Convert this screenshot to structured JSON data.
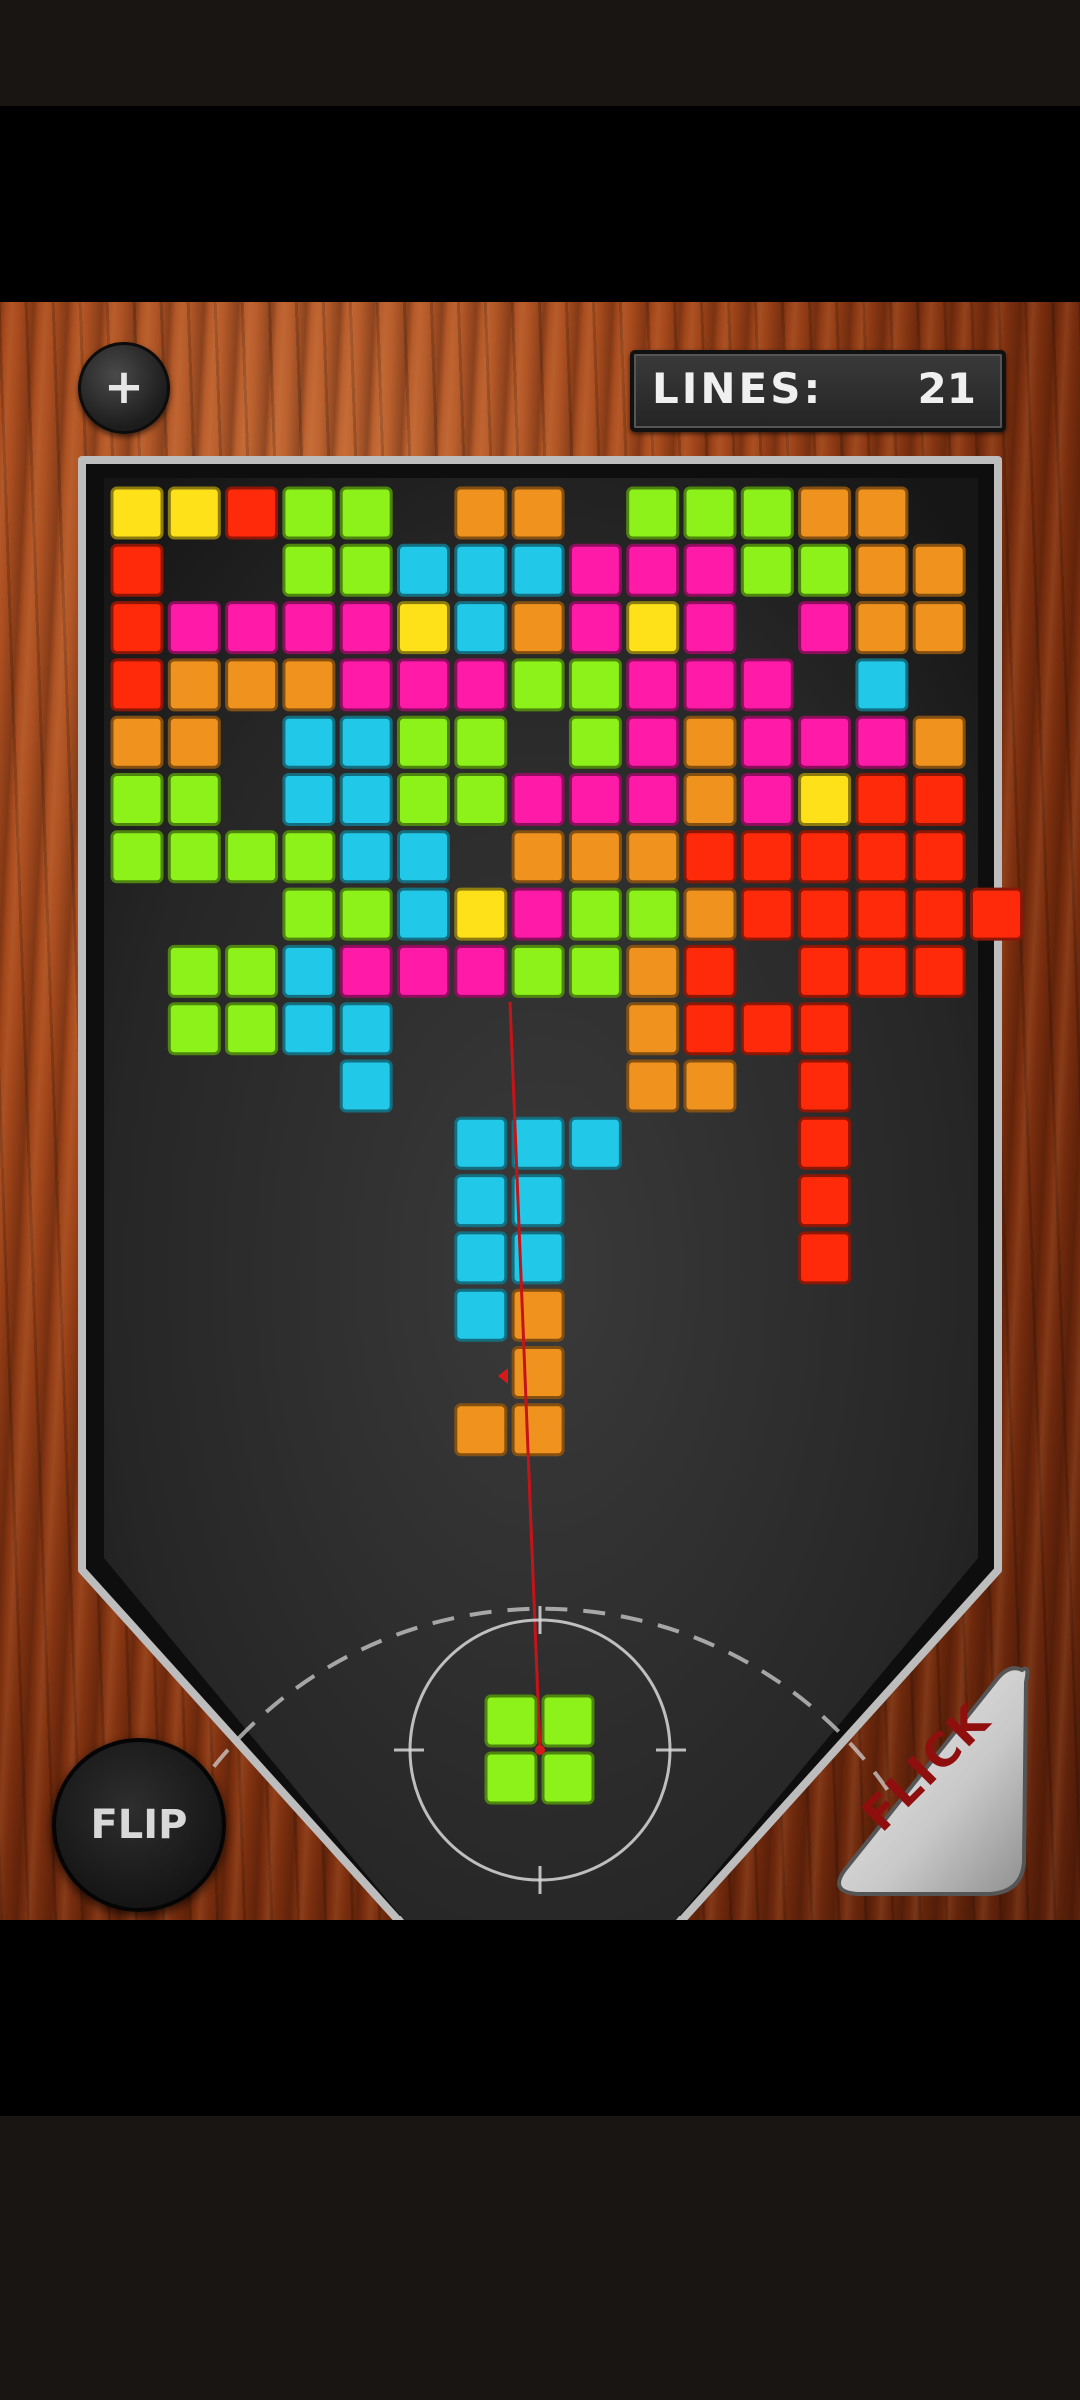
{
  "hud": {
    "menu_symbol": "+",
    "lines_label": "LINES:",
    "lines_value": "21"
  },
  "buttons": {
    "flip_label": "FLIP",
    "flick_label": "FLICK"
  },
  "colors": {
    "Y": "#ffe11a",
    "R": "#ff2a0a",
    "G": "#8cf21a",
    "O": "#f0921e",
    "C": "#22c8e8",
    "M": "#ff1aa8"
  },
  "grid": {
    "columns": 15,
    "rows": [
      "YYRGG.OO.GGGOO",
      "R..GGCCCMMMGGOO",
      "RMMMMYCOMYM.MOO",
      "ROOOMMMGGMMM.C.",
      "OO.CCGG.GMOMMMO",
      "GG.CCGGMMMOMYRR",
      "GGGGCC.OOORRRRR",
      "...GGCYMGGORRRRR",
      ".GGCMMMGGOR.RRR",
      ".GGCC....ORRR..",
      "....C....OO.R..",
      "......CCC...R..",
      "......CC....R..",
      "......CC....R..",
      "......CO.......",
      ".......O.......",
      "......OO......."
    ]
  },
  "launcher_piece": [
    "GG",
    "GG"
  ]
}
